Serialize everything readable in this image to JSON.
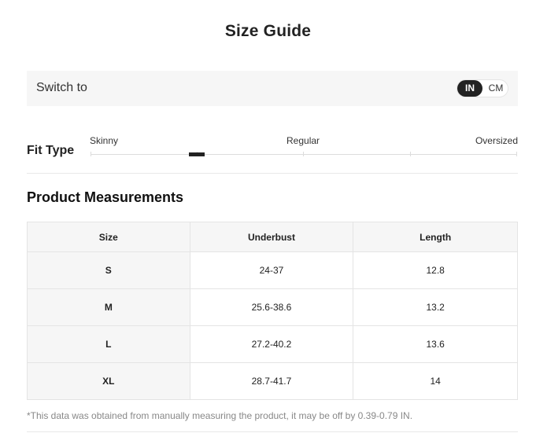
{
  "title": "Size Guide",
  "switch": {
    "label": "Switch to",
    "options": [
      "IN",
      "CM"
    ],
    "selected": "IN"
  },
  "fit_type": {
    "label": "Fit Type",
    "options": [
      "Skinny",
      "Regular",
      "Oversized"
    ]
  },
  "measurements": {
    "title": "Product Measurements",
    "columns": [
      "Size",
      "Underbust",
      "Length"
    ],
    "rows": [
      [
        "S",
        "24-37",
        "12.8"
      ],
      [
        "M",
        "25.6-38.6",
        "13.2"
      ],
      [
        "L",
        "27.2-40.2",
        "13.6"
      ],
      [
        "XL",
        "28.7-41.7",
        "14"
      ]
    ]
  },
  "footnote": "*This data was obtained from manually measuring the product, it may be off by 0.39-0.79 IN."
}
